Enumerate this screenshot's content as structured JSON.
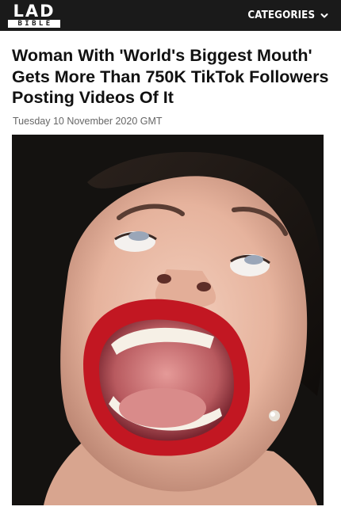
{
  "header": {
    "logo_top": "LAD",
    "logo_bottom": "BIBLE",
    "categories_label": "CATEGORIES",
    "chevron_icon": "chevron-down-icon",
    "background_color": "#1a1a1a"
  },
  "article": {
    "headline": "Woman With 'World's Biggest Mouth' Gets More Than 750K TikTok Followers Posting Videos Of It",
    "date": "Tuesday 10 November 2020 GMT"
  }
}
